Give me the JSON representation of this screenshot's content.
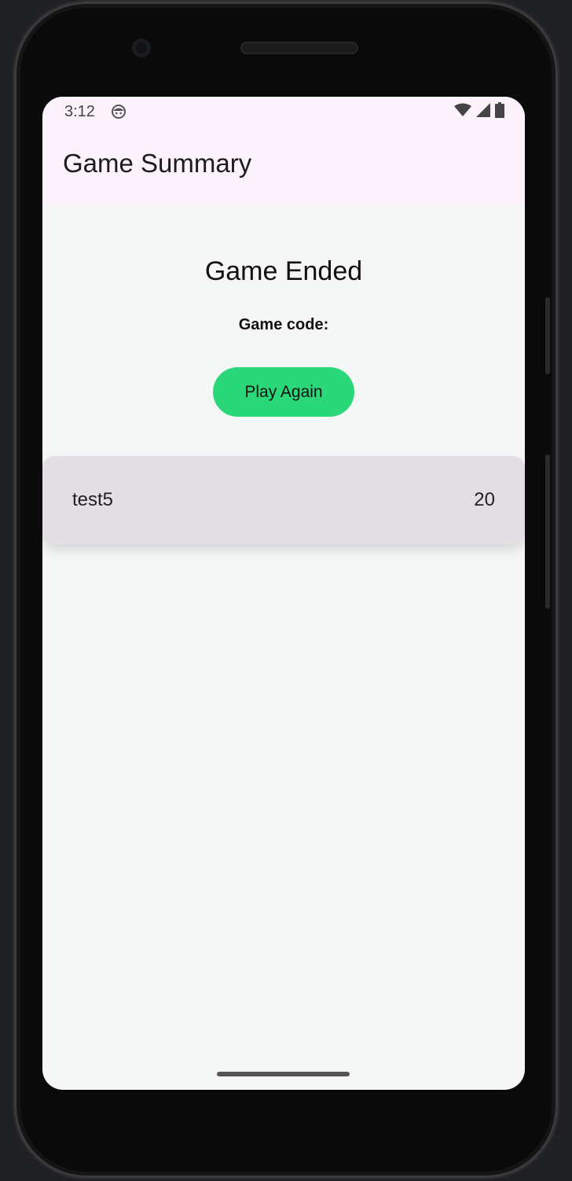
{
  "status_bar": {
    "time": "3:12",
    "icons": [
      "notification-face-icon",
      "wifi-icon",
      "cell-signal-icon",
      "battery-icon"
    ]
  },
  "app_bar": {
    "title": "Game Summary"
  },
  "main": {
    "heading": "Game Ended",
    "game_code_label": "Game code:",
    "play_again_label": "Play Again"
  },
  "scores": [
    {
      "name": "test5",
      "score": "20"
    }
  ],
  "colors": {
    "app_bar_bg": "#fbf2fb",
    "screen_bg": "#f4f7f6",
    "play_again_bg": "#2ad87a",
    "score_card_bg": "#e2dee4"
  }
}
